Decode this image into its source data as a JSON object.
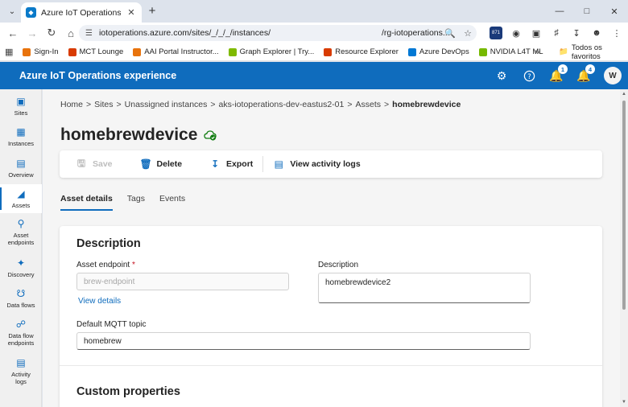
{
  "browser": {
    "tab_title": "Azure IoT Operations experience",
    "url_left": "iotoperations.azure.com/sites/_/_/_/instances/",
    "url_right": "/rg-iotoperations...",
    "ext_badge": "871",
    "bookmarks": [
      {
        "label": "Sign-In",
        "color": "#e8730c"
      },
      {
        "label": "MCT Lounge",
        "color": "#d83b01"
      },
      {
        "label": "AAI Portal Instructor...",
        "color": "#e8730c"
      },
      {
        "label": "Graph Explorer | Try...",
        "color": "#7fba00"
      },
      {
        "label": "Resource Explorer",
        "color": "#d83b01"
      },
      {
        "label": "Azure DevOps",
        "color": "#0078d4"
      },
      {
        "label": "NVIDIA L4T ML",
        "color": "#76b900"
      }
    ],
    "bookmarks_folder": "Todos os favoritos"
  },
  "app": {
    "title": "Azure IoT Operations experience",
    "help_badge": "1",
    "notif_badge": "4",
    "avatar_initial": "W",
    "accent": "#0f6cbd"
  },
  "sidenav": [
    {
      "label": "Sites",
      "icon": "sites-icon"
    },
    {
      "label": "Instances",
      "icon": "instances-icon"
    },
    {
      "label": "Overview",
      "icon": "overview-icon"
    },
    {
      "label": "Assets",
      "icon": "assets-icon",
      "active": true
    },
    {
      "label": "Asset endpoints",
      "icon": "asset-endpoints-icon"
    },
    {
      "label": "Discovery",
      "icon": "discovery-icon"
    },
    {
      "label": "Data flows",
      "icon": "data-flows-icon"
    },
    {
      "label": "Data flow endpoints",
      "icon": "data-flow-endpoints-icon"
    },
    {
      "label": "Activity logs",
      "icon": "activity-logs-icon"
    }
  ],
  "breadcrumb": [
    "Home",
    "Sites",
    "Unassigned instances",
    "aks-iotoperations-dev-eastus2-01",
    "Assets",
    "homebrewdevice"
  ],
  "page": {
    "title": "homebrewdevice",
    "commands": {
      "save": "Save",
      "delete": "Delete",
      "export": "Export",
      "activity": "View activity logs"
    },
    "tabs": [
      "Asset details",
      "Tags",
      "Events"
    ]
  },
  "form": {
    "section_title": "Description",
    "asset_endpoint_label": "Asset endpoint",
    "asset_endpoint_placeholder": "brew-endpoint",
    "view_details": "View details",
    "description_label": "Description",
    "description_value": "homebrewdevice2",
    "mqtt_label": "Default MQTT topic",
    "mqtt_value": "homebrew",
    "custom_title": "Custom properties"
  }
}
